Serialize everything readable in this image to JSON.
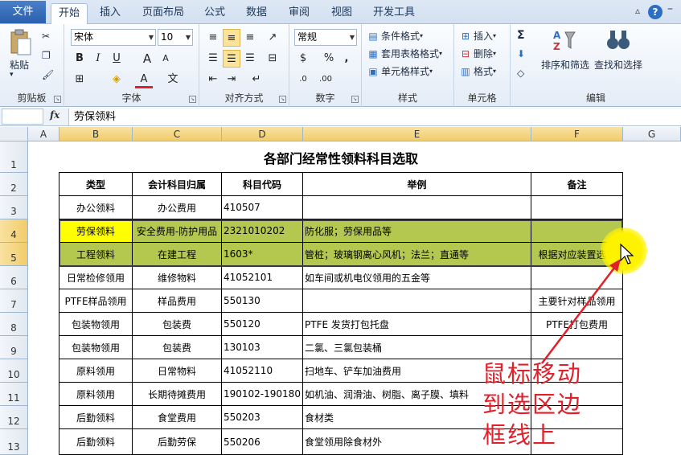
{
  "ribbon_tabs": [
    "文件",
    "开始",
    "插入",
    "页面布局",
    "公式",
    "数据",
    "审阅",
    "视图",
    "开发工具"
  ],
  "window_controls": [
    "▵",
    "?",
    "–",
    "□",
    "✕"
  ],
  "clipboard": {
    "paste": "粘贴",
    "label": "剪贴板"
  },
  "font": {
    "name": "宋体",
    "size": "10",
    "bold": "B",
    "italic": "I",
    "underline": "U",
    "grow": "A",
    "shrink": "A",
    "color_a": "A",
    "label": "字体"
  },
  "alignment": {
    "label": "对齐方式"
  },
  "number": {
    "format": "常规",
    "percent": "%",
    "comma": ",",
    "label": "数字"
  },
  "styles": {
    "conditional": "条件格式",
    "table": "套用表格格式",
    "cell": "单元格样式",
    "label": "样式"
  },
  "cells": {
    "insert": "插入",
    "delete": "删除",
    "format": "格式",
    "label": "单元格"
  },
  "editing": {
    "sum": "Σ",
    "sort_filter": "排序和筛选",
    "find_select": "查找和选择",
    "label": "编辑"
  },
  "formula_bar": {
    "fx": "fx",
    "content": "劳保领料"
  },
  "columns": [
    "A",
    "B",
    "C",
    "D",
    "E",
    "F",
    "G"
  ],
  "rows": [
    "1",
    "2",
    "3",
    "4",
    "5",
    "6",
    "7",
    "8",
    "9",
    "10",
    "11",
    "12",
    "13"
  ],
  "sheet": {
    "title": "各部门经常性领料科目选取",
    "headers": [
      "类型",
      "会计科目归属",
      "科目代码",
      "举例",
      "备注"
    ],
    "data": [
      [
        "办公领料",
        "办公费用",
        "410507",
        "",
        ""
      ],
      [
        "劳保领料",
        "安全费用-防护用品",
        "2321010202",
        "防化服；劳保用品等",
        ""
      ],
      [
        "工程领料",
        "在建工程",
        "1603*",
        "管桩；玻璃钢离心风机；法兰；直通等",
        "根据对应装置选取"
      ],
      [
        "日常检修领用",
        "维修物料",
        "41052101",
        "如车间或机电仪领用的五金等",
        ""
      ],
      [
        "PTFE样品领用",
        "样品费用",
        "550130",
        "",
        "主要针对样品领用"
      ],
      [
        "包装物领用",
        "包装费",
        "550120",
        "PTFE 发货打包托盘",
        "PTFE打包费用"
      ],
      [
        "包装物领用",
        "包装费",
        "130103",
        "二氯、三氯包装桶",
        ""
      ],
      [
        "原料领用",
        "日常物料",
        "41052110",
        "扫地车、铲车加油费用",
        ""
      ],
      [
        "原料领用",
        "长期待摊费用",
        "190102-190180",
        "如机油、润滑油、树脂、离子膜、填料",
        ""
      ],
      [
        "后勤领料",
        "食堂费用",
        "550203",
        "食材类",
        ""
      ],
      [
        "后勤领料",
        "后勤劳保",
        "550206",
        "食堂领用除食材外",
        ""
      ]
    ]
  },
  "annotation": [
    "鼠标移动",
    "到选区边",
    "框线上"
  ],
  "colors": {
    "selection_fill": "#b4c84f",
    "active_cell": "#ffff00",
    "annotation": "#e0202a"
  }
}
